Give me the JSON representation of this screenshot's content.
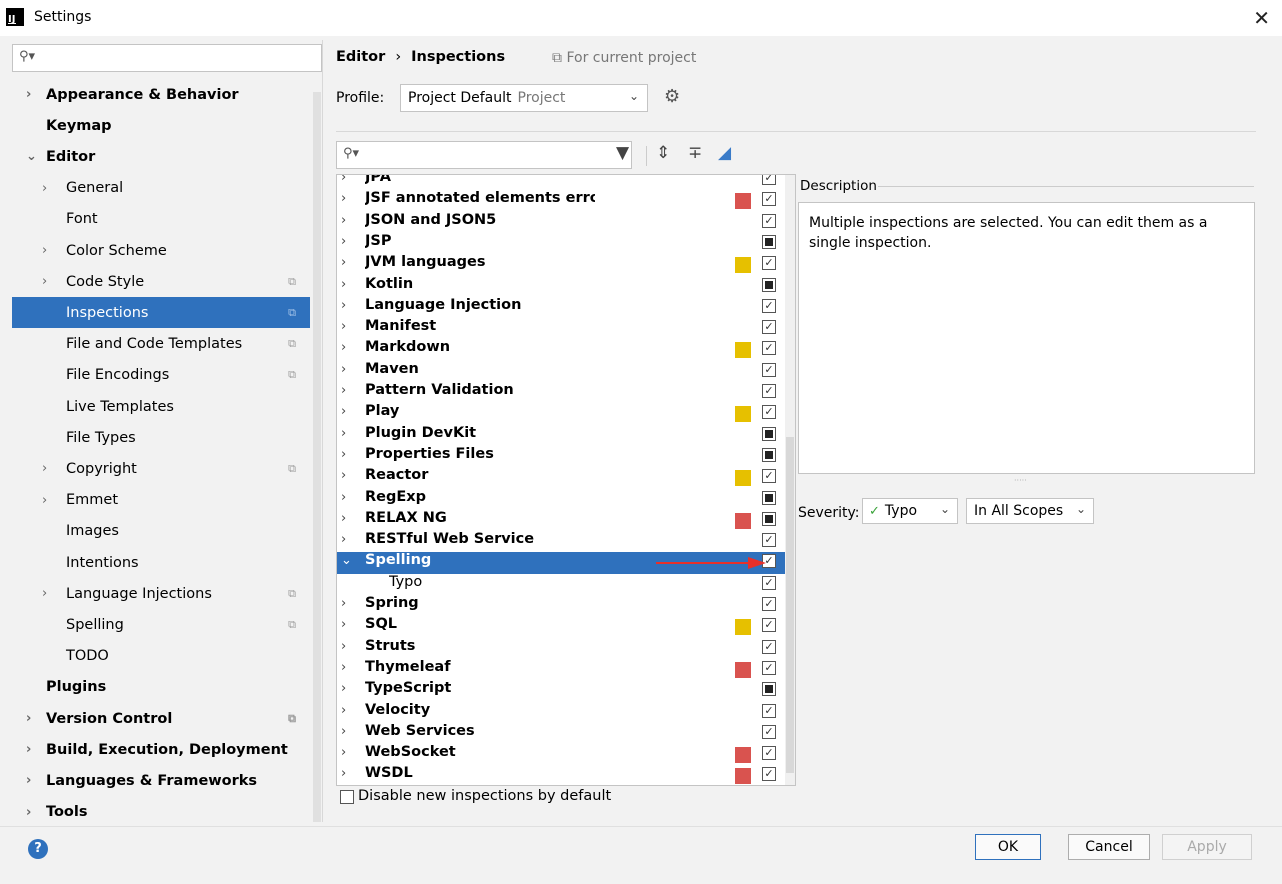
{
  "window": {
    "title": "Settings",
    "app_icon": "IJ"
  },
  "sidebar": {
    "search_placeholder": "",
    "items": [
      {
        "label": "Appearance & Behavior",
        "arrow": "›",
        "bold": true
      },
      {
        "label": "Keymap",
        "arrow": "",
        "bold": true
      },
      {
        "label": "Editor",
        "arrow": "⌄",
        "bold": true
      },
      {
        "label": "General",
        "arrow": "›",
        "bold": false
      },
      {
        "label": "Font",
        "arrow": "",
        "bold": false
      },
      {
        "label": "Color Scheme",
        "arrow": "›",
        "bold": false
      },
      {
        "label": "Code Style",
        "arrow": "›",
        "bold": false
      },
      {
        "label": "Inspections",
        "arrow": "",
        "bold": false
      },
      {
        "label": "File and Code Templates",
        "arrow": "",
        "bold": false
      },
      {
        "label": "File Encodings",
        "arrow": "",
        "bold": false
      },
      {
        "label": "Live Templates",
        "arrow": "",
        "bold": false
      },
      {
        "label": "File Types",
        "arrow": "",
        "bold": false
      },
      {
        "label": "Copyright",
        "arrow": "›",
        "bold": false
      },
      {
        "label": "Emmet",
        "arrow": "›",
        "bold": false
      },
      {
        "label": "Images",
        "arrow": "",
        "bold": false
      },
      {
        "label": "Intentions",
        "arrow": "",
        "bold": false
      },
      {
        "label": "Language Injections",
        "arrow": "›",
        "bold": false
      },
      {
        "label": "Spelling",
        "arrow": "",
        "bold": false
      },
      {
        "label": "TODO",
        "arrow": "",
        "bold": false
      },
      {
        "label": "Plugins",
        "arrow": "",
        "bold": true
      },
      {
        "label": "Version Control",
        "arrow": "›",
        "bold": true
      },
      {
        "label": "Build, Execution, Deployment",
        "arrow": "›",
        "bold": true
      },
      {
        "label": "Languages & Frameworks",
        "arrow": "›",
        "bold": true
      },
      {
        "label": "Tools",
        "arrow": "›",
        "bold": true
      }
    ],
    "selected_label": "Inspections"
  },
  "breadcrumb": {
    "parent": "Editor",
    "separator": "›",
    "current": "Inspections",
    "scope": "For current project"
  },
  "profile": {
    "label": "Profile:",
    "value": "Project Default",
    "sub": "Project"
  },
  "inspections": [
    {
      "label": "JPA",
      "severity": "",
      "state": "check"
    },
    {
      "label": "JSF annotated elements errors",
      "severity": "#d9534f",
      "state": "check"
    },
    {
      "label": "JSON and JSON5",
      "severity": "",
      "state": "check"
    },
    {
      "label": "JSP",
      "severity": "",
      "state": "partial"
    },
    {
      "label": "JVM languages",
      "severity": "#e6c000",
      "state": "check"
    },
    {
      "label": "Kotlin",
      "severity": "",
      "state": "partial"
    },
    {
      "label": "Language Injection",
      "severity": "",
      "state": "check"
    },
    {
      "label": "Manifest",
      "severity": "",
      "state": "check"
    },
    {
      "label": "Markdown",
      "severity": "#e6c000",
      "state": "check"
    },
    {
      "label": "Maven",
      "severity": "",
      "state": "check"
    },
    {
      "label": "Pattern Validation",
      "severity": "",
      "state": "check"
    },
    {
      "label": "Play",
      "severity": "#e6c000",
      "state": "check"
    },
    {
      "label": "Plugin DevKit",
      "severity": "",
      "state": "partial"
    },
    {
      "label": "Properties Files",
      "severity": "",
      "state": "partial"
    },
    {
      "label": "Reactor",
      "severity": "#e6c000",
      "state": "check"
    },
    {
      "label": "RegExp",
      "severity": "",
      "state": "partial"
    },
    {
      "label": "RELAX NG",
      "severity": "#d9534f",
      "state": "partial"
    },
    {
      "label": "RESTful Web Service",
      "severity": "",
      "state": "check"
    },
    {
      "label": "Spelling",
      "severity": "",
      "state": "check",
      "selected": true,
      "expanded": true
    },
    {
      "label": "Typo",
      "severity": "",
      "state": "check",
      "child": true
    },
    {
      "label": "Spring",
      "severity": "",
      "state": "check"
    },
    {
      "label": "SQL",
      "severity": "#e6c000",
      "state": "check"
    },
    {
      "label": "Struts",
      "severity": "",
      "state": "check"
    },
    {
      "label": "Thymeleaf",
      "severity": "#d9534f",
      "state": "check"
    },
    {
      "label": "TypeScript",
      "severity": "",
      "state": "partial"
    },
    {
      "label": "Velocity",
      "severity": "",
      "state": "check"
    },
    {
      "label": "Web Services",
      "severity": "",
      "state": "check"
    },
    {
      "label": "WebSocket",
      "severity": "#d9534f",
      "state": "check"
    },
    {
      "label": "WSDL",
      "severity": "#d9534f",
      "state": "check"
    }
  ],
  "disable_new": {
    "label": "Disable new inspections by default",
    "checked": false
  },
  "description": {
    "title": "Description",
    "text": "Multiple inspections are selected. You can edit them as a single inspection."
  },
  "severity": {
    "label": "Severity:",
    "value": "Typo",
    "scope": "In All Scopes"
  },
  "buttons": {
    "ok": "OK",
    "cancel": "Cancel",
    "apply": "Apply",
    "help": "?"
  },
  "colors": {
    "accent": "#2f71bd",
    "error": "#d9534f",
    "warning": "#e6c000",
    "arrow": "#e8302a"
  }
}
